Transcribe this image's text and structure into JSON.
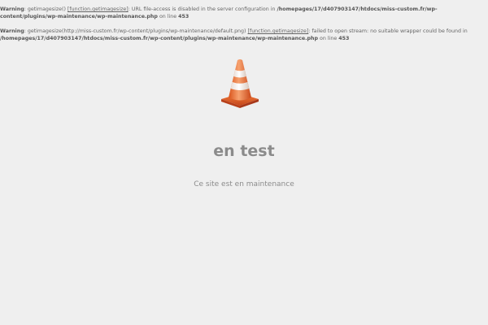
{
  "warnings": [
    {
      "level": "Warning",
      "func_text": ": getimagesize() ",
      "link_label": "[function.getimagesize]",
      "message": ": URL file-access is disabled in the server configuration in ",
      "file": "/homepages/17/d407903147/htdocs/miss-custom.fr/wp-content/plugins/wp-maintenance/wp-maintenance.php",
      "line_text": " on line ",
      "line_no": "453"
    },
    {
      "level": "Warning",
      "func_text": ": getimagesize(http://miss-custom.fr/wp-content/plugins/wp-maintenance/default.png) ",
      "link_label": "[function.getimagesize]",
      "message": ": failed to open stream: no suitable wrapper could be found in ",
      "file": "/homepages/17/d407903147/htdocs/miss-custom.fr/wp-content/plugins/wp-maintenance/wp-maintenance.php",
      "line_text": " on line ",
      "line_no": "453"
    }
  ],
  "maintenance": {
    "title": "en test",
    "message": "Ce site est en maintenance",
    "icon": "traffic-cone-icon",
    "cone_color": "#f26b2a"
  }
}
